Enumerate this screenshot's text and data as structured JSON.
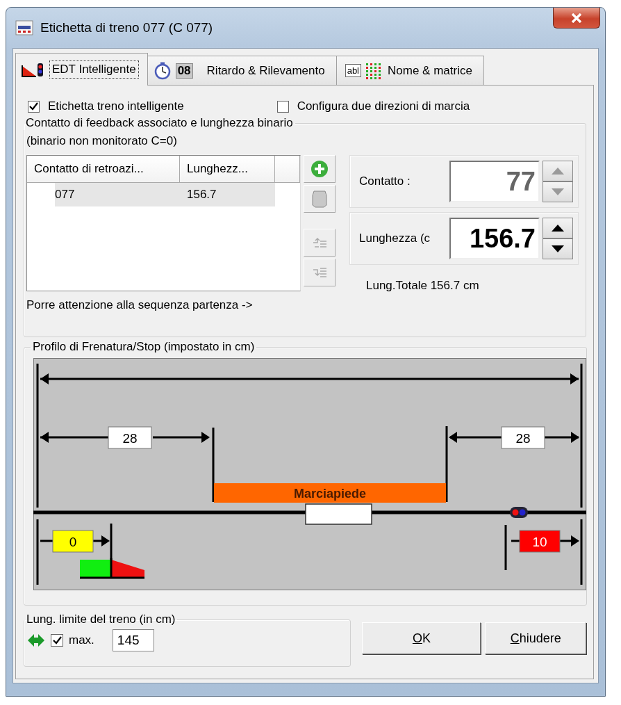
{
  "window": {
    "title": "Etichetta di treno 077 (C 077)"
  },
  "tabs": [
    {
      "label": "EDT Intelligente",
      "selected": true,
      "kind": "smart"
    },
    {
      "label": "Ritardo & Rilevamento",
      "selected": false,
      "kind": "delay",
      "badge": "08"
    },
    {
      "label": "Nome & matrice",
      "selected": false,
      "kind": "name",
      "badge": "abl"
    }
  ],
  "options": [
    {
      "label": "Etichetta treno intelligente",
      "checked": true
    },
    {
      "label": "Configura due direzioni di marcia",
      "checked": false
    }
  ],
  "feedback_group": {
    "title": "Contatto di feedback associato e lunghezza binario",
    "note": "(binario non monitorato C=0)",
    "table": {
      "columns": [
        "Contatto di retroazi...",
        "Lunghezz..."
      ],
      "rows": [
        {
          "cells": [
            "077",
            "156.7"
          ],
          "selected": true
        }
      ]
    },
    "warning": "Porre attenzione alla sequenza partenza ->",
    "contact": {
      "label": "Contatto :",
      "value": "77",
      "disabled": true
    },
    "length": {
      "label": "Lunghezza (c",
      "value": "156.7",
      "disabled": false
    },
    "total": "Lung.Totale 156.7 cm"
  },
  "brake_profile": {
    "title": "Profilo di Frenatura/Stop (impostato in cm)",
    "left_distance": "28",
    "right_distance": "28",
    "platform": "Marciapiede",
    "start_value": "0",
    "stop_value": "10"
  },
  "train_limit": {
    "title": "Lung. limite del treno (in cm)",
    "checked": true,
    "label": "max.",
    "value": "145"
  },
  "buttons": [
    {
      "label": "OK",
      "access_key_underlined": true
    },
    {
      "label": "Chiudere",
      "access_key_underlined": true
    }
  ]
}
